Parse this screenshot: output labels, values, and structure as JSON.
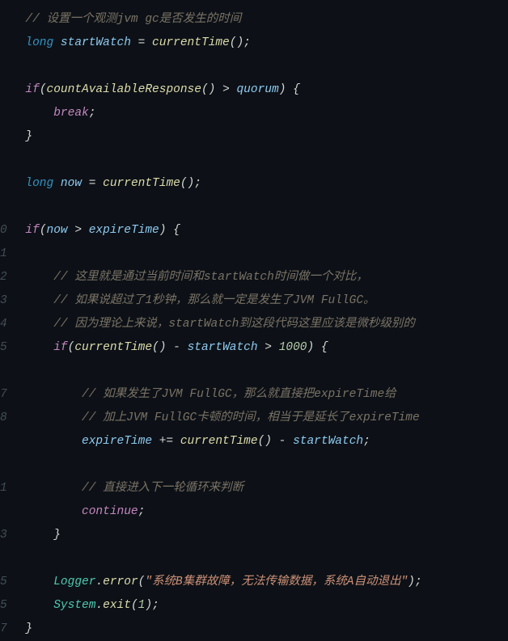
{
  "code": {
    "lines": [
      {
        "num": "",
        "t": [
          {
            "c": "tok-comment",
            "s": "// 设置一个观测jvm gc是否发生的时间"
          }
        ]
      },
      {
        "num": "",
        "t": [
          {
            "c": "tok-type",
            "s": "long"
          },
          {
            "c": "tok-punc",
            "s": " "
          },
          {
            "c": "tok-var",
            "s": "startWatch"
          },
          {
            "c": "tok-punc",
            "s": " "
          },
          {
            "c": "tok-op",
            "s": "="
          },
          {
            "c": "tok-punc",
            "s": " "
          },
          {
            "c": "tok-func",
            "s": "currentTime"
          },
          {
            "c": "tok-punc",
            "s": "();"
          }
        ]
      },
      {
        "num": "",
        "t": []
      },
      {
        "num": "",
        "t": [
          {
            "c": "tok-control",
            "s": "if"
          },
          {
            "c": "tok-punc",
            "s": "("
          },
          {
            "c": "tok-func",
            "s": "countAvailableResponse"
          },
          {
            "c": "tok-punc",
            "s": "() "
          },
          {
            "c": "tok-op",
            "s": ">"
          },
          {
            "c": "tok-punc",
            "s": " "
          },
          {
            "c": "tok-var",
            "s": "quorum"
          },
          {
            "c": "tok-punc",
            "s": ") {"
          }
        ]
      },
      {
        "num": "",
        "indent": 1,
        "t": [
          {
            "c": "tok-keyword",
            "s": "break"
          },
          {
            "c": "tok-punc",
            "s": ";"
          }
        ]
      },
      {
        "num": "",
        "t": [
          {
            "c": "tok-punc",
            "s": "}"
          }
        ]
      },
      {
        "num": "",
        "t": []
      },
      {
        "num": "",
        "t": [
          {
            "c": "tok-type",
            "s": "long"
          },
          {
            "c": "tok-punc",
            "s": " "
          },
          {
            "c": "tok-var",
            "s": "now"
          },
          {
            "c": "tok-punc",
            "s": " "
          },
          {
            "c": "tok-op",
            "s": "="
          },
          {
            "c": "tok-punc",
            "s": " "
          },
          {
            "c": "tok-func",
            "s": "currentTime"
          },
          {
            "c": "tok-punc",
            "s": "();"
          }
        ]
      },
      {
        "num": "",
        "t": []
      },
      {
        "num": "0",
        "t": [
          {
            "c": "tok-control",
            "s": "if"
          },
          {
            "c": "tok-punc",
            "s": "("
          },
          {
            "c": "tok-var",
            "s": "now"
          },
          {
            "c": "tok-punc",
            "s": " "
          },
          {
            "c": "tok-op",
            "s": ">"
          },
          {
            "c": "tok-punc",
            "s": " "
          },
          {
            "c": "tok-var",
            "s": "expireTime"
          },
          {
            "c": "tok-punc",
            "s": ") {"
          }
        ]
      },
      {
        "num": "1",
        "t": []
      },
      {
        "num": "2",
        "indent": 1,
        "t": [
          {
            "c": "tok-comment",
            "s": "// 这里就是通过当前时间和startWatch时间做一个对比，"
          }
        ]
      },
      {
        "num": "3",
        "indent": 1,
        "t": [
          {
            "c": "tok-comment",
            "s": "// 如果说超过了1秒钟，那么就一定是发生了JVM FullGC。"
          }
        ]
      },
      {
        "num": "4",
        "indent": 1,
        "t": [
          {
            "c": "tok-comment",
            "s": "// 因为理论上来说，startWatch到这段代码这里应该是微秒级别的"
          }
        ]
      },
      {
        "num": "5",
        "indent": 1,
        "t": [
          {
            "c": "tok-control",
            "s": "if"
          },
          {
            "c": "tok-punc",
            "s": "("
          },
          {
            "c": "tok-func",
            "s": "currentTime"
          },
          {
            "c": "tok-punc",
            "s": "() "
          },
          {
            "c": "tok-op",
            "s": "-"
          },
          {
            "c": "tok-punc",
            "s": " "
          },
          {
            "c": "tok-var",
            "s": "startWatch"
          },
          {
            "c": "tok-punc",
            "s": " "
          },
          {
            "c": "tok-op",
            "s": ">"
          },
          {
            "c": "tok-punc",
            "s": " "
          },
          {
            "c": "tok-num",
            "s": "1000"
          },
          {
            "c": "tok-punc",
            "s": ") {"
          }
        ]
      },
      {
        "num": "",
        "t": []
      },
      {
        "num": "7",
        "indent": 2,
        "t": [
          {
            "c": "tok-comment",
            "s": "// 如果发生了JVM FullGC，那么就直接把expireTime给"
          }
        ]
      },
      {
        "num": "8",
        "indent": 2,
        "t": [
          {
            "c": "tok-comment",
            "s": "// 加上JVM FullGC卡顿的时间，相当于是延长了expireTime"
          }
        ]
      },
      {
        "num": "",
        "indent": 2,
        "t": [
          {
            "c": "tok-var",
            "s": "expireTime"
          },
          {
            "c": "tok-punc",
            "s": " "
          },
          {
            "c": "tok-op",
            "s": "+="
          },
          {
            "c": "tok-punc",
            "s": " "
          },
          {
            "c": "tok-func",
            "s": "currentTime"
          },
          {
            "c": "tok-punc",
            "s": "() "
          },
          {
            "c": "tok-op",
            "s": "-"
          },
          {
            "c": "tok-punc",
            "s": " "
          },
          {
            "c": "tok-var",
            "s": "startWatch"
          },
          {
            "c": "tok-punc",
            "s": ";"
          }
        ]
      },
      {
        "num": "",
        "t": []
      },
      {
        "num": "1",
        "indent": 2,
        "t": [
          {
            "c": "tok-comment",
            "s": "// 直接进入下一轮循环来判断"
          }
        ]
      },
      {
        "num": "",
        "indent": 2,
        "t": [
          {
            "c": "tok-keyword",
            "s": "continue"
          },
          {
            "c": "tok-punc",
            "s": ";"
          }
        ]
      },
      {
        "num": "3",
        "indent": 1,
        "t": [
          {
            "c": "tok-punc",
            "s": "}"
          }
        ]
      },
      {
        "num": "",
        "t": []
      },
      {
        "num": "5",
        "indent": 1,
        "t": [
          {
            "c": "tok-class",
            "s": "Logger"
          },
          {
            "c": "tok-punc",
            "s": "."
          },
          {
            "c": "tok-func",
            "s": "error"
          },
          {
            "c": "tok-punc",
            "s": "("
          },
          {
            "c": "tok-str",
            "s": "\"系统B集群故障，无法传输数据，系统A自动退出\""
          },
          {
            "c": "tok-punc",
            "s": ");"
          }
        ]
      },
      {
        "num": "5",
        "indent": 1,
        "t": [
          {
            "c": "tok-class",
            "s": "System"
          },
          {
            "c": "tok-punc",
            "s": "."
          },
          {
            "c": "tok-func",
            "s": "exit"
          },
          {
            "c": "tok-punc",
            "s": "("
          },
          {
            "c": "tok-num",
            "s": "1"
          },
          {
            "c": "tok-punc",
            "s": ");"
          }
        ]
      },
      {
        "num": "7",
        "t": [
          {
            "c": "tok-punc",
            "s": "}"
          }
        ]
      }
    ]
  }
}
